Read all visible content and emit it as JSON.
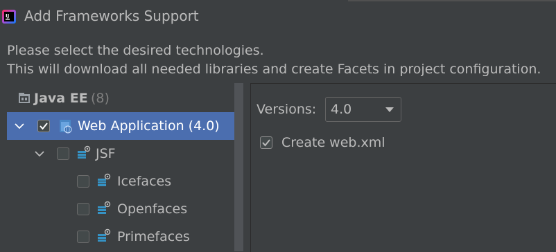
{
  "window": {
    "title": "Add Frameworks Support",
    "app_icon": "intellij-icon"
  },
  "description": {
    "line1": "Please select the desired technologies.",
    "line2": "This will download all needed libraries and create Facets in project configuration."
  },
  "tree": {
    "group": {
      "label": "Java EE",
      "count": "(8)",
      "icon": "javaee-icon"
    },
    "items": [
      {
        "label": "Web Application (4.0)",
        "checked": true,
        "expanded": true,
        "selected": true,
        "icon": "web-module-icon"
      },
      {
        "label": "JSF",
        "checked": false,
        "expanded": true,
        "selected": false,
        "icon": "jsf-icon"
      },
      {
        "label": "Icefaces",
        "checked": false,
        "selected": false,
        "icon": "jsf-icon"
      },
      {
        "label": "Openfaces",
        "checked": false,
        "selected": false,
        "icon": "jsf-icon"
      },
      {
        "label": "Primefaces",
        "checked": false,
        "selected": false,
        "icon": "jsf-icon"
      }
    ]
  },
  "details": {
    "versions_label": "Versions:",
    "version_value": "4.0",
    "create_webxml_label": "Create web.xml",
    "create_webxml_checked": true
  },
  "colors": {
    "background": "#3c3f41",
    "selection": "#4b6eaf",
    "text": "#bbbbbb"
  }
}
